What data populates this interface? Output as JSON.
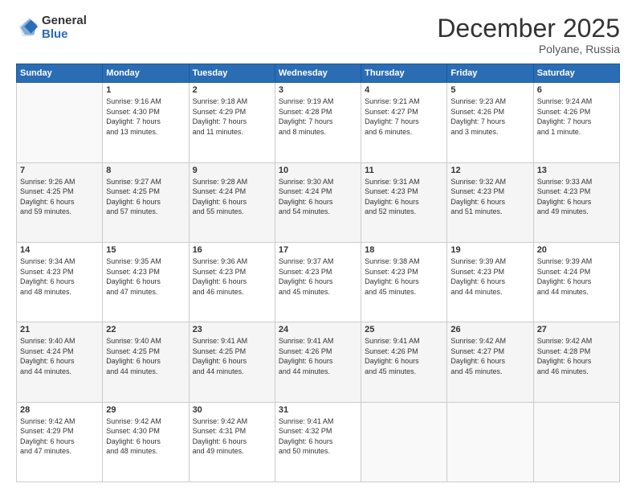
{
  "logo": {
    "general": "General",
    "blue": "Blue"
  },
  "header": {
    "month": "December 2025",
    "location": "Polyane, Russia"
  },
  "weekdays": [
    "Sunday",
    "Monday",
    "Tuesday",
    "Wednesday",
    "Thursday",
    "Friday",
    "Saturday"
  ],
  "weeks": [
    [
      {
        "day": "",
        "info": ""
      },
      {
        "day": "1",
        "info": "Sunrise: 9:16 AM\nSunset: 4:30 PM\nDaylight: 7 hours\nand 13 minutes."
      },
      {
        "day": "2",
        "info": "Sunrise: 9:18 AM\nSunset: 4:29 PM\nDaylight: 7 hours\nand 11 minutes."
      },
      {
        "day": "3",
        "info": "Sunrise: 9:19 AM\nSunset: 4:28 PM\nDaylight: 7 hours\nand 8 minutes."
      },
      {
        "day": "4",
        "info": "Sunrise: 9:21 AM\nSunset: 4:27 PM\nDaylight: 7 hours\nand 6 minutes."
      },
      {
        "day": "5",
        "info": "Sunrise: 9:23 AM\nSunset: 4:26 PM\nDaylight: 7 hours\nand 3 minutes."
      },
      {
        "day": "6",
        "info": "Sunrise: 9:24 AM\nSunset: 4:26 PM\nDaylight: 7 hours\nand 1 minute."
      }
    ],
    [
      {
        "day": "7",
        "info": "Sunrise: 9:26 AM\nSunset: 4:25 PM\nDaylight: 6 hours\nand 59 minutes."
      },
      {
        "day": "8",
        "info": "Sunrise: 9:27 AM\nSunset: 4:25 PM\nDaylight: 6 hours\nand 57 minutes."
      },
      {
        "day": "9",
        "info": "Sunrise: 9:28 AM\nSunset: 4:24 PM\nDaylight: 6 hours\nand 55 minutes."
      },
      {
        "day": "10",
        "info": "Sunrise: 9:30 AM\nSunset: 4:24 PM\nDaylight: 6 hours\nand 54 minutes."
      },
      {
        "day": "11",
        "info": "Sunrise: 9:31 AM\nSunset: 4:23 PM\nDaylight: 6 hours\nand 52 minutes."
      },
      {
        "day": "12",
        "info": "Sunrise: 9:32 AM\nSunset: 4:23 PM\nDaylight: 6 hours\nand 51 minutes."
      },
      {
        "day": "13",
        "info": "Sunrise: 9:33 AM\nSunset: 4:23 PM\nDaylight: 6 hours\nand 49 minutes."
      }
    ],
    [
      {
        "day": "14",
        "info": "Sunrise: 9:34 AM\nSunset: 4:23 PM\nDaylight: 6 hours\nand 48 minutes."
      },
      {
        "day": "15",
        "info": "Sunrise: 9:35 AM\nSunset: 4:23 PM\nDaylight: 6 hours\nand 47 minutes."
      },
      {
        "day": "16",
        "info": "Sunrise: 9:36 AM\nSunset: 4:23 PM\nDaylight: 6 hours\nand 46 minutes."
      },
      {
        "day": "17",
        "info": "Sunrise: 9:37 AM\nSunset: 4:23 PM\nDaylight: 6 hours\nand 45 minutes."
      },
      {
        "day": "18",
        "info": "Sunrise: 9:38 AM\nSunset: 4:23 PM\nDaylight: 6 hours\nand 45 minutes."
      },
      {
        "day": "19",
        "info": "Sunrise: 9:39 AM\nSunset: 4:23 PM\nDaylight: 6 hours\nand 44 minutes."
      },
      {
        "day": "20",
        "info": "Sunrise: 9:39 AM\nSunset: 4:24 PM\nDaylight: 6 hours\nand 44 minutes."
      }
    ],
    [
      {
        "day": "21",
        "info": "Sunrise: 9:40 AM\nSunset: 4:24 PM\nDaylight: 6 hours\nand 44 minutes."
      },
      {
        "day": "22",
        "info": "Sunrise: 9:40 AM\nSunset: 4:25 PM\nDaylight: 6 hours\nand 44 minutes."
      },
      {
        "day": "23",
        "info": "Sunrise: 9:41 AM\nSunset: 4:25 PM\nDaylight: 6 hours\nand 44 minutes."
      },
      {
        "day": "24",
        "info": "Sunrise: 9:41 AM\nSunset: 4:26 PM\nDaylight: 6 hours\nand 44 minutes."
      },
      {
        "day": "25",
        "info": "Sunrise: 9:41 AM\nSunset: 4:26 PM\nDaylight: 6 hours\nand 45 minutes."
      },
      {
        "day": "26",
        "info": "Sunrise: 9:42 AM\nSunset: 4:27 PM\nDaylight: 6 hours\nand 45 minutes."
      },
      {
        "day": "27",
        "info": "Sunrise: 9:42 AM\nSunset: 4:28 PM\nDaylight: 6 hours\nand 46 minutes."
      }
    ],
    [
      {
        "day": "28",
        "info": "Sunrise: 9:42 AM\nSunset: 4:29 PM\nDaylight: 6 hours\nand 47 minutes."
      },
      {
        "day": "29",
        "info": "Sunrise: 9:42 AM\nSunset: 4:30 PM\nDaylight: 6 hours\nand 48 minutes."
      },
      {
        "day": "30",
        "info": "Sunrise: 9:42 AM\nSunset: 4:31 PM\nDaylight: 6 hours\nand 49 minutes."
      },
      {
        "day": "31",
        "info": "Sunrise: 9:41 AM\nSunset: 4:32 PM\nDaylight: 6 hours\nand 50 minutes."
      },
      {
        "day": "",
        "info": ""
      },
      {
        "day": "",
        "info": ""
      },
      {
        "day": "",
        "info": ""
      }
    ]
  ]
}
